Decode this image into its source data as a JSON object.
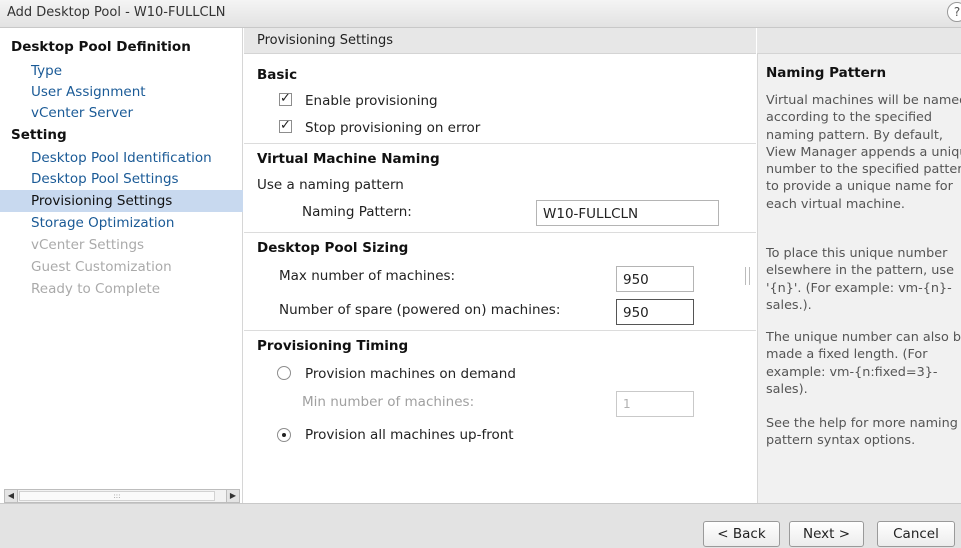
{
  "window": {
    "title": "Add Desktop Pool - W10-FULLCLN",
    "help": "?"
  },
  "nav": {
    "section1": "Desktop Pool Definition",
    "items1": [
      "Type",
      "User Assignment",
      "vCenter Server"
    ],
    "section2": "Setting",
    "items2": [
      "Desktop Pool Identification",
      "Desktop Pool Settings",
      "Provisioning Settings",
      "Storage Optimization",
      "vCenter Settings",
      "Guest Customization",
      "Ready to Complete"
    ],
    "scroll_grip": ":::"
  },
  "main": {
    "header": "Provisioning Settings",
    "basic": {
      "heading": "Basic",
      "enable_label": "Enable provisioning",
      "stop_label": "Stop provisioning on error"
    },
    "naming": {
      "heading": "Virtual Machine Naming",
      "use_pattern": "Use a naming pattern",
      "pattern_label": "Naming Pattern:",
      "pattern_value": "W10-FULLCLN"
    },
    "sizing": {
      "heading": "Desktop Pool Sizing",
      "max_label": "Max number of machines:",
      "max_value": "950",
      "spare_label": "Number of spare (powered on) machines:",
      "spare_value": "950"
    },
    "timing": {
      "heading": "Provisioning Timing",
      "on_demand": "Provision machines on demand",
      "min_label": "Min number of machines:",
      "min_value": "1",
      "up_front": "Provision all machines up-front"
    }
  },
  "help": {
    "title": "Naming Pattern",
    "p1": "Virtual machines will be named according to the specified naming pattern. By default, View Manager appends a unique number to the specified pattern to provide a unique name for each virtual machine.",
    "p2": "To place this unique number elsewhere in the pattern, use '{n}'. (For example: vm-{n}-sales.).",
    "p3": "The unique number can also be made a fixed length. (For example: vm-{n:fixed=3}-sales).",
    "p4": "See the help for more naming pattern syntax options."
  },
  "footer": {
    "back": "< Back",
    "next": "Next >",
    "cancel": "Cancel"
  }
}
